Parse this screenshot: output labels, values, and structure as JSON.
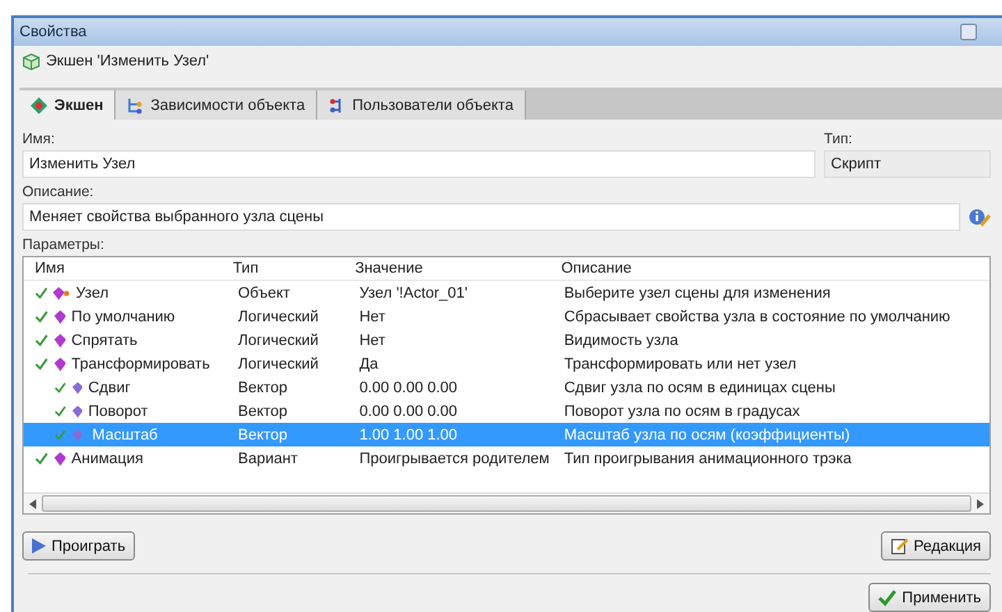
{
  "window": {
    "title": "Свойства"
  },
  "header": {
    "title": "Экшен 'Изменить Узел'"
  },
  "tabs": [
    {
      "label": "Экшен",
      "selected": true
    },
    {
      "label": "Зависимости объекта",
      "selected": false
    },
    {
      "label": "Пользователи объекта",
      "selected": false
    }
  ],
  "name_field": {
    "label": "Имя:",
    "value": "Изменить Узел"
  },
  "type_field": {
    "label": "Тип:",
    "value": "Скрипт"
  },
  "description_field": {
    "label": "Описание:",
    "value": "Меняет свойства выбранного узла сцены"
  },
  "parameters": {
    "label": "Параметры:",
    "columns": [
      "Имя",
      "Тип",
      "Значение",
      "Описание"
    ],
    "rows": [
      {
        "name": "Узел",
        "type": "Объект",
        "value": "Узел '!Actor_01'",
        "description": "Выберите узел сцены для изменения",
        "selected": false,
        "kind": "object"
      },
      {
        "name": "По умолчанию",
        "type": "Логический",
        "value": "Нет",
        "description": "Сбрасывает свойства узла в состояние по умолчанию",
        "selected": false,
        "kind": "plain"
      },
      {
        "name": "Спрятать",
        "type": "Логический",
        "value": "Нет",
        "description": "Видимость узла",
        "selected": false,
        "kind": "plain"
      },
      {
        "name": "Трансформировать",
        "type": "Логический",
        "value": "Да",
        "description": "Трансформировать или нет узел",
        "selected": false,
        "kind": "plain",
        "children": [
          {
            "name": "Сдвиг",
            "type": "Вектор",
            "value": "0.00  0.00  0.00",
            "description": "Сдвиг узла по осям в единицах сцены",
            "selected": false,
            "kind": "plain"
          },
          {
            "name": "Поворот",
            "type": "Вектор",
            "value": "0.00  0.00  0.00",
            "description": "Поворот узла по осям в градусах",
            "selected": false,
            "kind": "plain"
          },
          {
            "name": "Масштаб",
            "type": "Вектор",
            "value": "1.00  1.00  1.00",
            "description": "Масштаб узла по осям (коэффициенты)",
            "selected": true,
            "kind": "plain"
          }
        ]
      },
      {
        "name": "Анимация",
        "type": "Вариант",
        "value": "Проигрывается родителем",
        "description": "Тип проигрывания анимационного трэка",
        "selected": false,
        "kind": "plain"
      }
    ]
  },
  "buttons": {
    "play": "Проиграть",
    "edit": "Редакция",
    "apply": "Применить"
  }
}
